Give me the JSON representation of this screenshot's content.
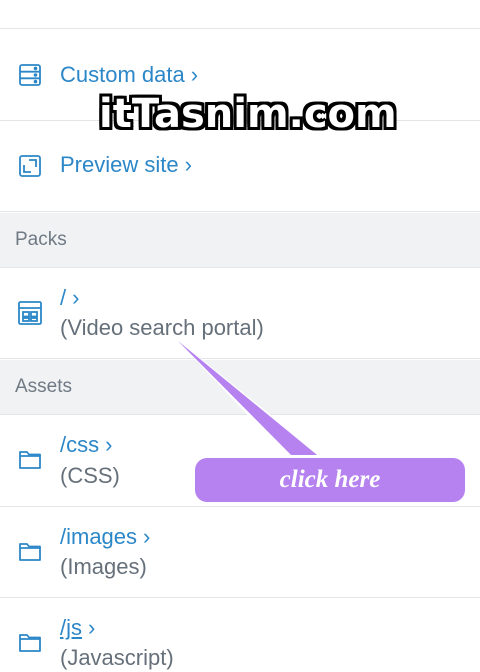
{
  "items_top": [
    {
      "label": "Custom data",
      "icon": "server-icon"
    },
    {
      "label": "Preview site",
      "icon": "preview-icon"
    }
  ],
  "sections": {
    "packs": "Packs",
    "assets": "Assets"
  },
  "packs": [
    {
      "path": "/",
      "description": "(Video search portal)",
      "icon": "layout-icon"
    }
  ],
  "assets": [
    {
      "path": "/css",
      "description": "(CSS)",
      "icon": "folder-icon"
    },
    {
      "path": "/images",
      "description": "(Images)",
      "icon": "folder-icon"
    },
    {
      "path": "/js",
      "description": "(Javascript)",
      "icon": "folder-icon"
    }
  ],
  "chevron": "›",
  "watermark": "itTasnim.com",
  "callout": {
    "text": "click here",
    "color": "#b582f0"
  },
  "colors": {
    "link": "#2c87c8",
    "subtext": "#66707a",
    "section_bg": "#f0f2f4"
  }
}
